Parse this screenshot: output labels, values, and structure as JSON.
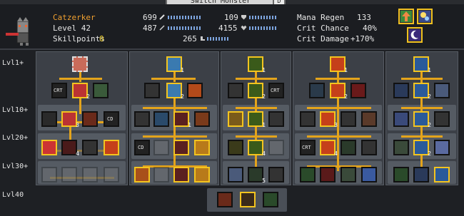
{
  "window": {
    "title": "Switch Monster",
    "close_label": "D"
  },
  "hero": {
    "name": "Catzerker",
    "level": "Level 42",
    "skillpoints_label": "Skillpoints",
    "skillpoints_value": "0"
  },
  "stats": {
    "attack": "699",
    "defense": "109",
    "magic": "487",
    "hp": "4155",
    "speed": "265",
    "mana_regen_label": "Mana Regen",
    "mana_regen_value": "133",
    "crit_chance_label": "Crit Chance",
    "crit_chance_value": "40%",
    "crit_damage_label": "Crit Damage",
    "crit_damage_value": "+170%"
  },
  "levels": [
    "Lvl1+",
    "Lvl10+",
    "Lvl20+",
    "Lvl30+",
    "Lvl40"
  ],
  "tree": {
    "cell_labels": {
      "crit": "CRT",
      "cooldown": "CD"
    },
    "counts": [
      "1",
      "2",
      "3",
      "4",
      "5"
    ]
  },
  "colors": {
    "highlight": "#f3c41f",
    "branch": "#e4a41b",
    "panel": "#3c4047",
    "name": "#f0a030"
  }
}
